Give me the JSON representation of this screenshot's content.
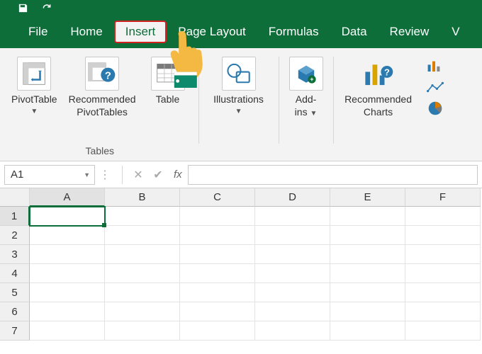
{
  "qat": {
    "save_icon": "save-icon",
    "redo_icon": "redo-icon"
  },
  "tabs": {
    "file": "File",
    "home": "Home",
    "insert": "Insert",
    "page_layout": "Page Layout",
    "formulas": "Formulas",
    "data": "Data",
    "review": "Review",
    "view_partial": "V"
  },
  "ribbon": {
    "tables": {
      "pivot": "PivotTable",
      "recommended_pivot_l1": "Recommended",
      "recommended_pivot_l2": "PivotTables",
      "table": "Table",
      "group_label": "Tables"
    },
    "illustrations": {
      "label": "Illustrations"
    },
    "addins": {
      "l1": "Add-",
      "l2": "ins"
    },
    "reccharts": {
      "l1": "Recommended",
      "l2": "Charts"
    }
  },
  "formulabar": {
    "namebox": "A1",
    "fx": "fx",
    "value": ""
  },
  "grid": {
    "columns": [
      "A",
      "B",
      "C",
      "D",
      "E",
      "F"
    ],
    "rows": [
      "1",
      "2",
      "3",
      "4",
      "5",
      "6",
      "7"
    ],
    "active_cell": "A1"
  }
}
